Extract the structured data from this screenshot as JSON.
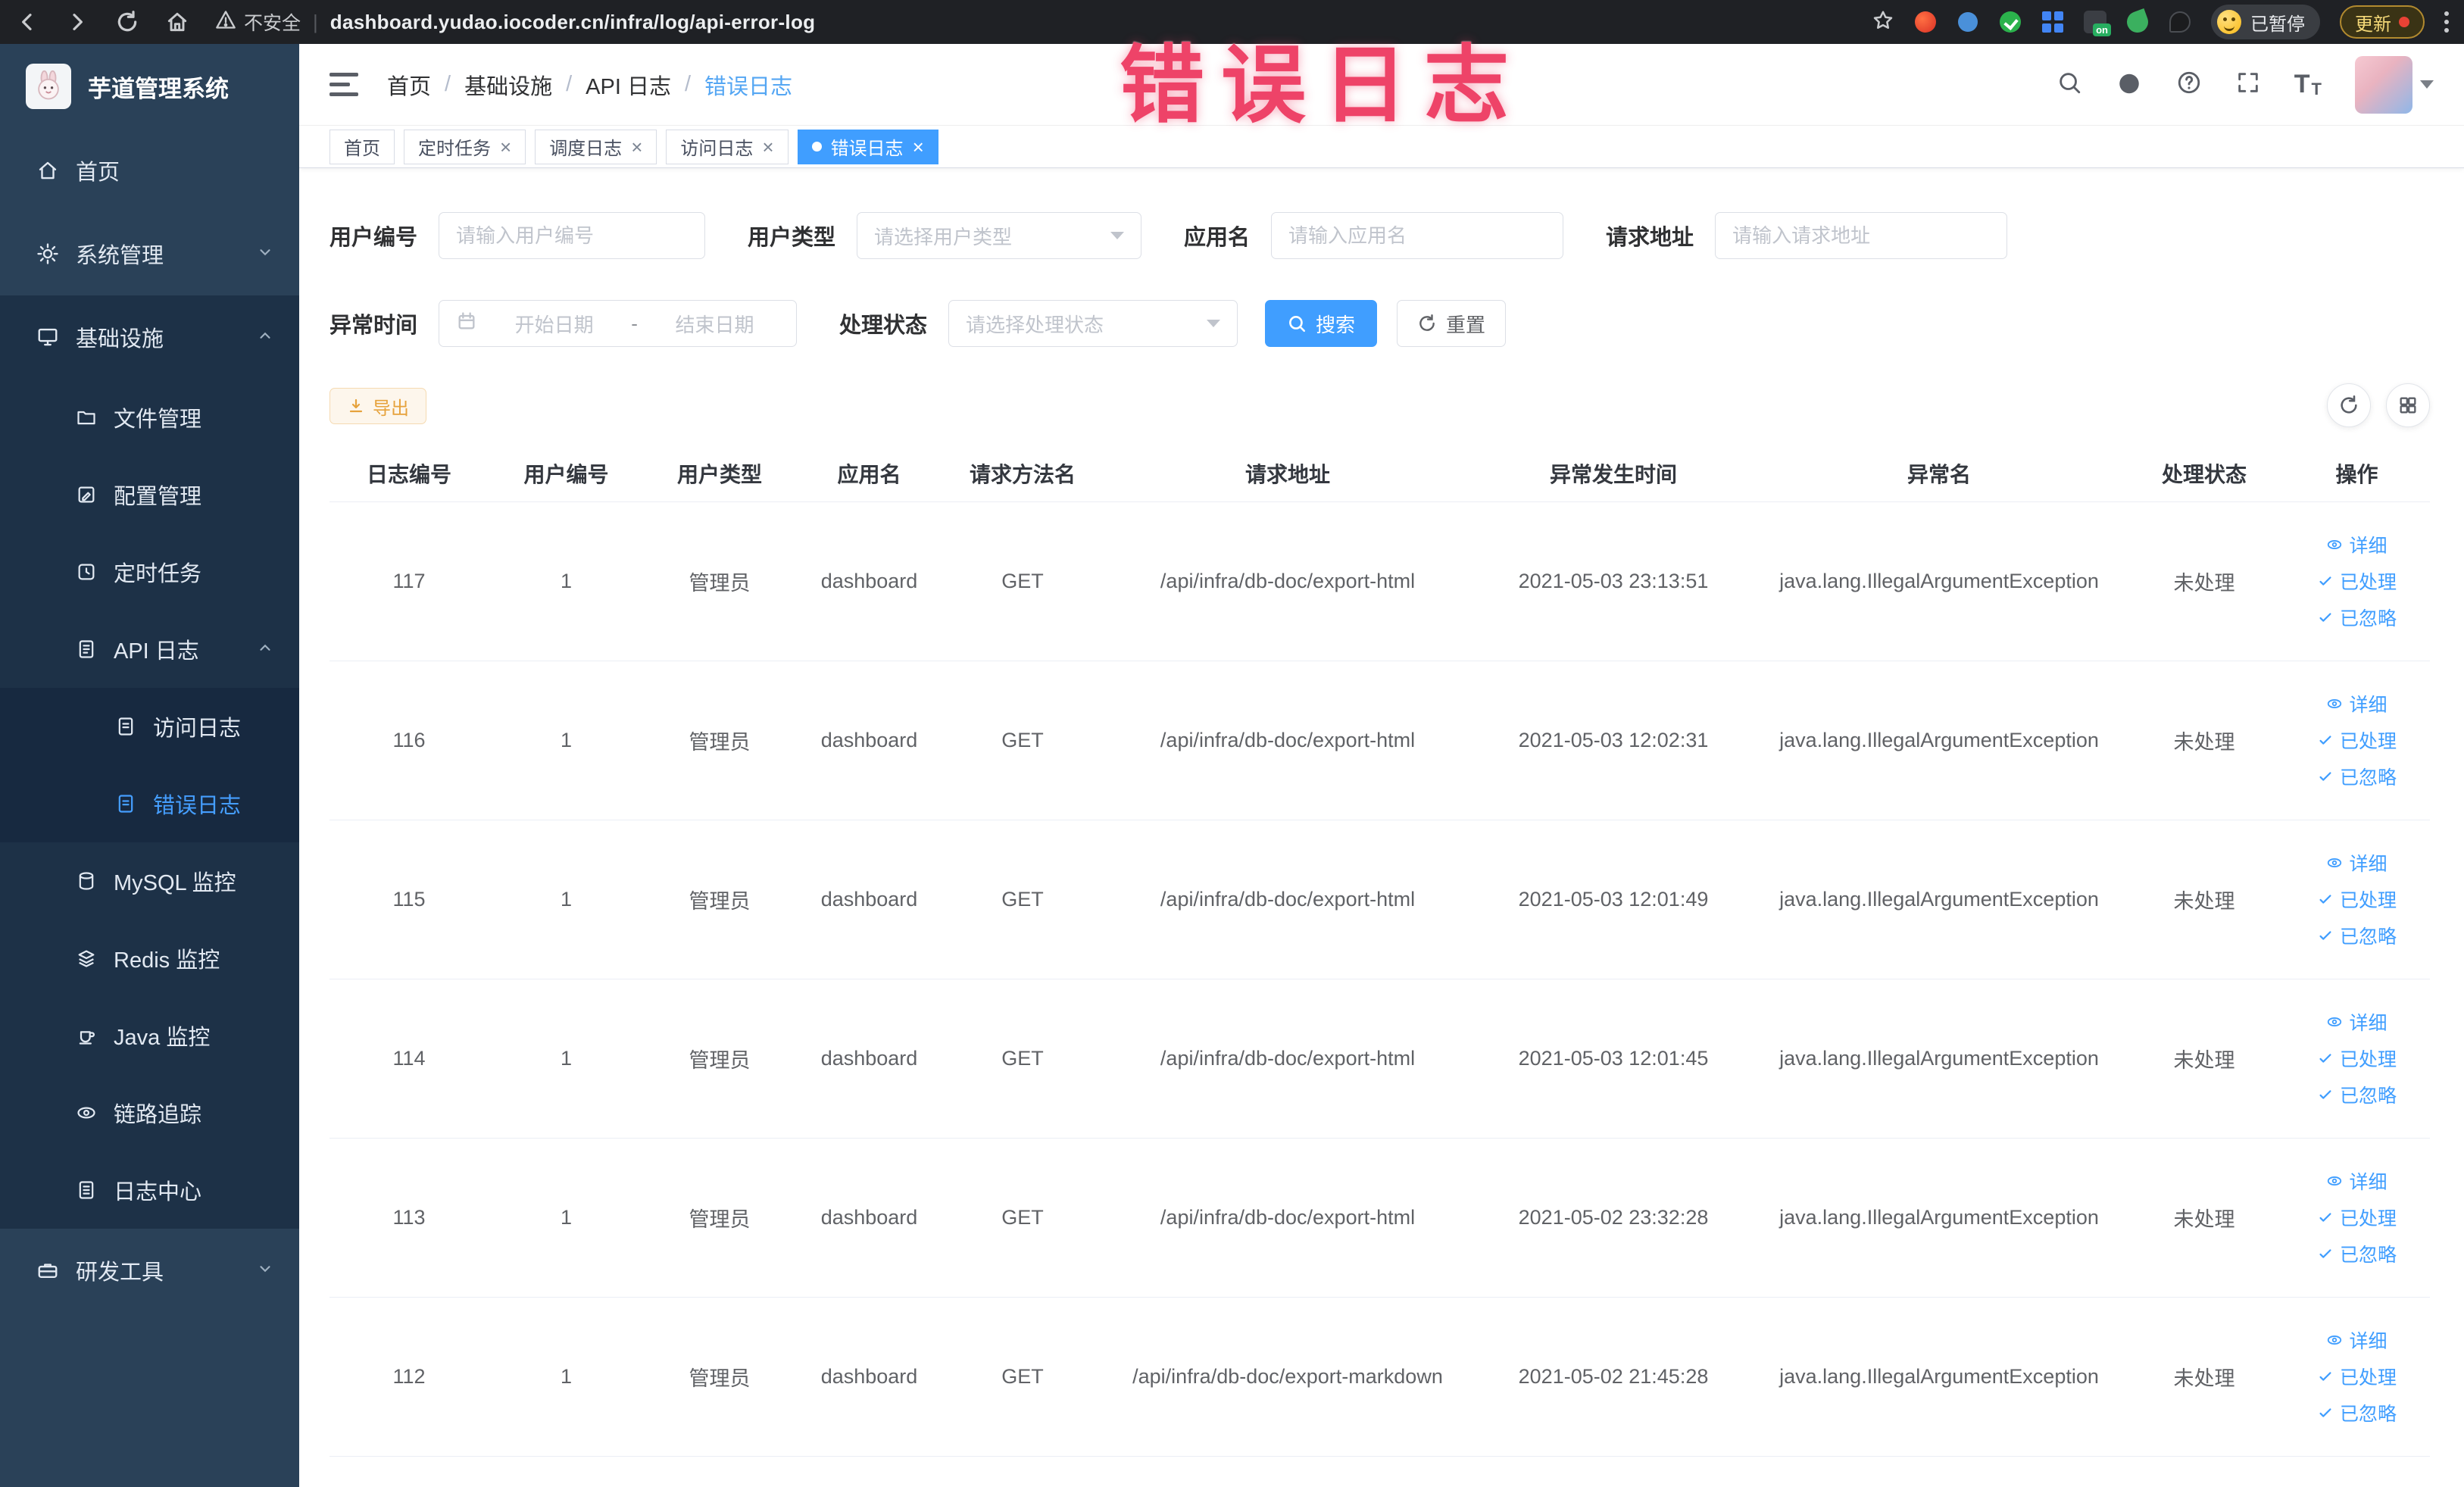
{
  "browser": {
    "security_label": "不安全",
    "url": "dashboard.yudao.iocoder.cn/infra/log/api-error-log",
    "profile_badge": "已暂停",
    "update_button": "更新",
    "on_badge": "on",
    "icons": [
      "back-icon",
      "forward-icon",
      "reload-icon",
      "home-icon",
      "warning-icon",
      "bookmark-star-icon",
      "extension-icons",
      "profile-avatar",
      "browser-menu-icon"
    ]
  },
  "annotation": {
    "text": "错误日志",
    "color": "#ee4368"
  },
  "sidebar": {
    "logo_title": "芋道管理系统",
    "items": [
      {
        "label": "首页",
        "level": 1
      },
      {
        "label": "系统管理",
        "level": 1,
        "state": "collapsed"
      },
      {
        "label": "基础设施",
        "level": 1,
        "state": "expanded"
      },
      {
        "label": "文件管理",
        "level": 2
      },
      {
        "label": "配置管理",
        "level": 2
      },
      {
        "label": "定时任务",
        "level": 2
      },
      {
        "label": "API 日志",
        "level": 2,
        "state": "expanded"
      },
      {
        "label": "访问日志",
        "level": 3
      },
      {
        "label": "错误日志",
        "level": 3,
        "active": true
      },
      {
        "label": "MySQL 监控",
        "level": 2
      },
      {
        "label": "Redis 监控",
        "level": 2
      },
      {
        "label": "Java 监控",
        "level": 2
      },
      {
        "label": "链路追踪",
        "level": 2
      },
      {
        "label": "日志中心",
        "level": 2
      },
      {
        "label": "研发工具",
        "level": 1,
        "state": "collapsed"
      }
    ]
  },
  "breadcrumb": {
    "items": [
      "首页",
      "基础设施",
      "API 日志",
      "错误日志"
    ]
  },
  "header_icons": [
    "search-icon",
    "github-icon",
    "help-icon",
    "fullscreen-icon",
    "font-size-icon",
    "user-avatar",
    "caret-down-icon"
  ],
  "tabs": [
    {
      "label": "首页",
      "closable": false,
      "active": false
    },
    {
      "label": "定时任务",
      "closable": true,
      "active": false
    },
    {
      "label": "调度日志",
      "closable": true,
      "active": false
    },
    {
      "label": "访问日志",
      "closable": true,
      "active": false
    },
    {
      "label": "错误日志",
      "closable": true,
      "active": true
    }
  ],
  "filters": {
    "user_id": {
      "label": "用户编号",
      "placeholder": "请输入用户编号",
      "value": ""
    },
    "user_type": {
      "label": "用户类型",
      "placeholder": "请选择用户类型",
      "value": ""
    },
    "app_name": {
      "label": "应用名",
      "placeholder": "请输入应用名",
      "value": ""
    },
    "request_url": {
      "label": "请求地址",
      "placeholder": "请输入请求地址",
      "value": ""
    },
    "exception_time": {
      "label": "异常时间",
      "start_placeholder": "开始日期",
      "separator": "-",
      "end_placeholder": "结束日期",
      "value": ""
    },
    "process_status": {
      "label": "处理状态",
      "placeholder": "请选择处理状态",
      "value": ""
    },
    "search_button": "搜索",
    "reset_button": "重置"
  },
  "toolbar": {
    "export_button": "导出"
  },
  "table": {
    "columns": [
      "日志编号",
      "用户编号",
      "用户类型",
      "应用名",
      "请求方法名",
      "请求地址",
      "异常发生时间",
      "异常名",
      "处理状态",
      "操作"
    ],
    "row_actions": [
      "详细",
      "已处理",
      "已忽略"
    ],
    "rows": [
      {
        "id": "117",
        "user_id": "1",
        "user_type": "管理员",
        "app_name": "dashboard",
        "method": "GET",
        "url": "/api/infra/db-doc/export-html",
        "time": "2021-05-03 23:13:51",
        "exception": "java.lang.IllegalArgumentException",
        "status": "未处理"
      },
      {
        "id": "116",
        "user_id": "1",
        "user_type": "管理员",
        "app_name": "dashboard",
        "method": "GET",
        "url": "/api/infra/db-doc/export-html",
        "time": "2021-05-03 12:02:31",
        "exception": "java.lang.IllegalArgumentException",
        "status": "未处理"
      },
      {
        "id": "115",
        "user_id": "1",
        "user_type": "管理员",
        "app_name": "dashboard",
        "method": "GET",
        "url": "/api/infra/db-doc/export-html",
        "time": "2021-05-03 12:01:49",
        "exception": "java.lang.IllegalArgumentException",
        "status": "未处理"
      },
      {
        "id": "114",
        "user_id": "1",
        "user_type": "管理员",
        "app_name": "dashboard",
        "method": "GET",
        "url": "/api/infra/db-doc/export-html",
        "time": "2021-05-03 12:01:45",
        "exception": "java.lang.IllegalArgumentException",
        "status": "未处理"
      },
      {
        "id": "113",
        "user_id": "1",
        "user_type": "管理员",
        "app_name": "dashboard",
        "method": "GET",
        "url": "/api/infra/db-doc/export-html",
        "time": "2021-05-02 23:32:28",
        "exception": "java.lang.IllegalArgumentException",
        "status": "未处理"
      },
      {
        "id": "112",
        "user_id": "1",
        "user_type": "管理员",
        "app_name": "dashboard",
        "method": "GET",
        "url": "/api/infra/db-doc/export-markdown",
        "time": "2021-05-02 21:45:28",
        "exception": "java.lang.IllegalArgumentException",
        "status": "未处理"
      }
    ]
  },
  "colors": {
    "primary": "#409eff",
    "warning_text": "#e6a23c",
    "warning_bg": "#fdf6ec",
    "warning_border": "#f5dab1",
    "sidebar_bg": "#2a4158",
    "annotation": "#ee4368"
  }
}
